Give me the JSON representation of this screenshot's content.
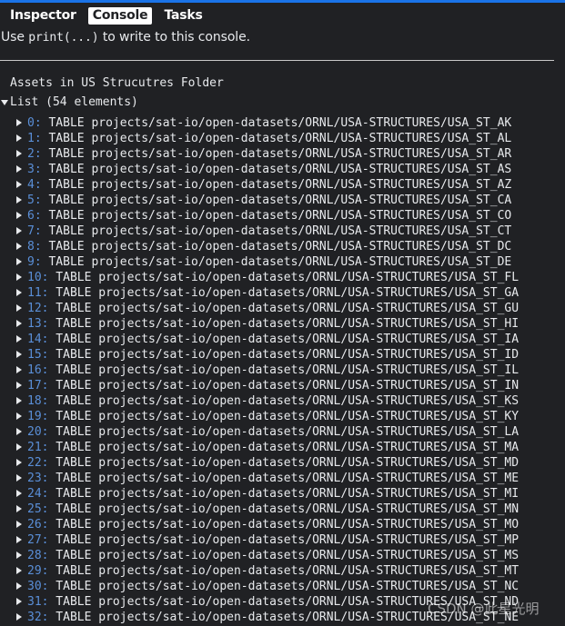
{
  "tabs": [
    "Inspector",
    "Console",
    "Tasks"
  ],
  "console": {
    "hint_prefix": "Use ",
    "hint_code": "print(...)",
    "hint_suffix": " to write to this console.",
    "heading": "Assets in US Strucutres Folder",
    "list_label": "List (54 elements)"
  },
  "rows": [
    {
      "index": "0:",
      "text": " TABLE projects/sat-io/open-datasets/ORNL/USA-STRUCTURES/USA_ST_AK"
    },
    {
      "index": "1:",
      "text": " TABLE projects/sat-io/open-datasets/ORNL/USA-STRUCTURES/USA_ST_AL"
    },
    {
      "index": "2:",
      "text": " TABLE projects/sat-io/open-datasets/ORNL/USA-STRUCTURES/USA_ST_AR"
    },
    {
      "index": "3:",
      "text": " TABLE projects/sat-io/open-datasets/ORNL/USA-STRUCTURES/USA_ST_AS"
    },
    {
      "index": "4:",
      "text": " TABLE projects/sat-io/open-datasets/ORNL/USA-STRUCTURES/USA_ST_AZ"
    },
    {
      "index": "5:",
      "text": " TABLE projects/sat-io/open-datasets/ORNL/USA-STRUCTURES/USA_ST_CA"
    },
    {
      "index": "6:",
      "text": " TABLE projects/sat-io/open-datasets/ORNL/USA-STRUCTURES/USA_ST_CO"
    },
    {
      "index": "7:",
      "text": " TABLE projects/sat-io/open-datasets/ORNL/USA-STRUCTURES/USA_ST_CT"
    },
    {
      "index": "8:",
      "text": " TABLE projects/sat-io/open-datasets/ORNL/USA-STRUCTURES/USA_ST_DC"
    },
    {
      "index": "9:",
      "text": " TABLE projects/sat-io/open-datasets/ORNL/USA-STRUCTURES/USA_ST_DE"
    },
    {
      "index": "10:",
      "text": " TABLE projects/sat-io/open-datasets/ORNL/USA-STRUCTURES/USA_ST_FL"
    },
    {
      "index": "11:",
      "text": " TABLE projects/sat-io/open-datasets/ORNL/USA-STRUCTURES/USA_ST_GA"
    },
    {
      "index": "12:",
      "text": " TABLE projects/sat-io/open-datasets/ORNL/USA-STRUCTURES/USA_ST_GU"
    },
    {
      "index": "13:",
      "text": " TABLE projects/sat-io/open-datasets/ORNL/USA-STRUCTURES/USA_ST_HI"
    },
    {
      "index": "14:",
      "text": " TABLE projects/sat-io/open-datasets/ORNL/USA-STRUCTURES/USA_ST_IA"
    },
    {
      "index": "15:",
      "text": " TABLE projects/sat-io/open-datasets/ORNL/USA-STRUCTURES/USA_ST_ID"
    },
    {
      "index": "16:",
      "text": " TABLE projects/sat-io/open-datasets/ORNL/USA-STRUCTURES/USA_ST_IL"
    },
    {
      "index": "17:",
      "text": " TABLE projects/sat-io/open-datasets/ORNL/USA-STRUCTURES/USA_ST_IN"
    },
    {
      "index": "18:",
      "text": " TABLE projects/sat-io/open-datasets/ORNL/USA-STRUCTURES/USA_ST_KS"
    },
    {
      "index": "19:",
      "text": " TABLE projects/sat-io/open-datasets/ORNL/USA-STRUCTURES/USA_ST_KY"
    },
    {
      "index": "20:",
      "text": " TABLE projects/sat-io/open-datasets/ORNL/USA-STRUCTURES/USA_ST_LA"
    },
    {
      "index": "21:",
      "text": " TABLE projects/sat-io/open-datasets/ORNL/USA-STRUCTURES/USA_ST_MA"
    },
    {
      "index": "22:",
      "text": " TABLE projects/sat-io/open-datasets/ORNL/USA-STRUCTURES/USA_ST_MD"
    },
    {
      "index": "23:",
      "text": " TABLE projects/sat-io/open-datasets/ORNL/USA-STRUCTURES/USA_ST_ME"
    },
    {
      "index": "24:",
      "text": " TABLE projects/sat-io/open-datasets/ORNL/USA-STRUCTURES/USA_ST_MI"
    },
    {
      "index": "25:",
      "text": " TABLE projects/sat-io/open-datasets/ORNL/USA-STRUCTURES/USA_ST_MN"
    },
    {
      "index": "26:",
      "text": " TABLE projects/sat-io/open-datasets/ORNL/USA-STRUCTURES/USA_ST_MO"
    },
    {
      "index": "27:",
      "text": " TABLE projects/sat-io/open-datasets/ORNL/USA-STRUCTURES/USA_ST_MP"
    },
    {
      "index": "28:",
      "text": " TABLE projects/sat-io/open-datasets/ORNL/USA-STRUCTURES/USA_ST_MS"
    },
    {
      "index": "29:",
      "text": " TABLE projects/sat-io/open-datasets/ORNL/USA-STRUCTURES/USA_ST_MT"
    },
    {
      "index": "30:",
      "text": " TABLE projects/sat-io/open-datasets/ORNL/USA-STRUCTURES/USA_ST_NC"
    },
    {
      "index": "31:",
      "text": " TABLE projects/sat-io/open-datasets/ORNL/USA-STRUCTURES/USA_ST_ND"
    },
    {
      "index": "32:",
      "text": " TABLE projects/sat-io/open-datasets/ORNL/USA-STRUCTURES/USA_ST_NE"
    }
  ],
  "watermark": "CSDN @此星光明",
  "colors": {
    "accent": "#1a73e8",
    "index": "#5a8fd8",
    "background": "#202124"
  }
}
